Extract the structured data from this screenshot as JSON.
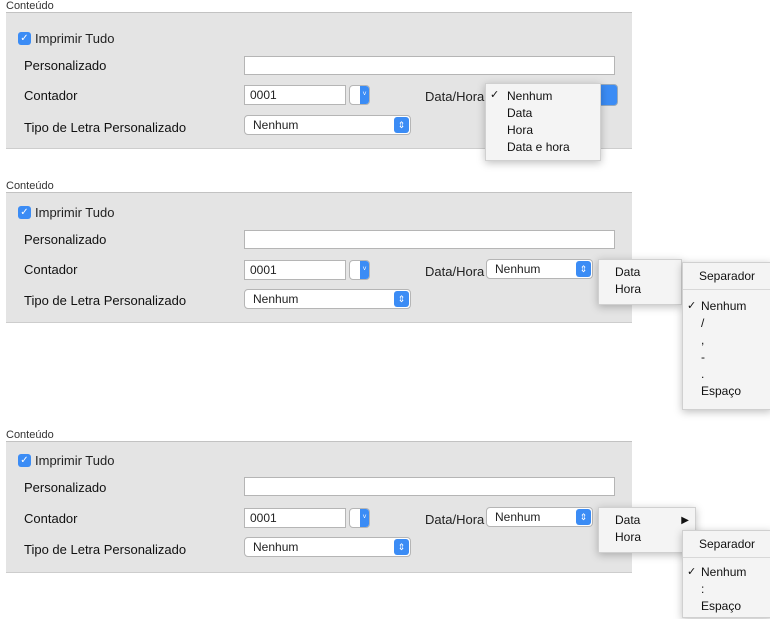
{
  "panels": [
    {
      "title": "Conteúdo",
      "print_all": "Imprimir Tudo",
      "custom_label": "Personalizado",
      "counter_label": "Contador",
      "counter_value": "0001",
      "datetime_label": "Data/Hora",
      "font_label": "Tipo de Letra Personalizado",
      "font_value": "Nenhum",
      "datetime_value": "Nenhum"
    },
    {
      "title": "Conteúdo",
      "print_all": "Imprimir Tudo",
      "custom_label": "Personalizado",
      "counter_label": "Contador",
      "counter_value": "0001",
      "datetime_label": "Data/Hora",
      "font_label": "Tipo de Letra Personalizado",
      "font_value": "Nenhum",
      "datetime_value": "Nenhum"
    },
    {
      "title": "Conteúdo",
      "print_all": "Imprimir Tudo",
      "custom_label": "Personalizado",
      "counter_label": "Contador",
      "counter_value": "0001",
      "datetime_label": "Data/Hora",
      "font_label": "Tipo de Letra Personalizado",
      "font_value": "Nenhum",
      "datetime_value": "Nenhum"
    }
  ],
  "menu1": {
    "items": [
      "Nenhum",
      "Data",
      "Hora",
      "Data e hora"
    ],
    "checked_index": 0
  },
  "menu2": {
    "items": [
      "Data",
      "Hora"
    ]
  },
  "submenu2": {
    "header": "Separador",
    "items": [
      "Nenhum",
      "/",
      ",",
      "-",
      ".",
      "Espaço"
    ]
  },
  "menu3": {
    "items": [
      "Data",
      "Hora"
    ]
  },
  "submenu3": {
    "header": "Separador",
    "items": [
      "Nenhum",
      ":",
      "Espaço"
    ]
  },
  "icons": {
    "check": "check-icon",
    "stepper": "stepper-icon",
    "popup_arrow": "popup-arrows-icon",
    "submenu_arrow": "submenu-arrow-icon"
  },
  "colors": {
    "accent": "#3b8cf5",
    "panel_bg": "#e4e4e4"
  }
}
